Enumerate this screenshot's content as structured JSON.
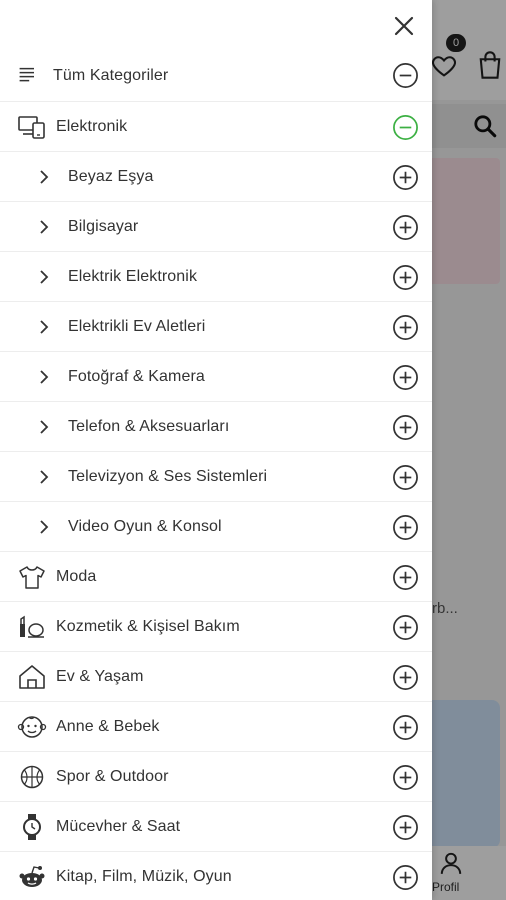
{
  "background": {
    "favorites_badge": "0",
    "product_card_text": "rb...",
    "bottom_nav": {
      "profile_label": "Profil"
    }
  },
  "drawer": {
    "all_categories": {
      "label": "Tüm Kategoriler",
      "icon": "list-icon",
      "state": "expanded"
    },
    "expanded_category": {
      "label": "Elektronik",
      "icon": "devices-icon",
      "state": "expanded",
      "accent": "#3cb043"
    },
    "subcategories": [
      {
        "label": "Beyaz Eşya"
      },
      {
        "label": "Bilgisayar"
      },
      {
        "label": "Elektrik Elektronik"
      },
      {
        "label": "Elektrikli Ev Aletleri"
      },
      {
        "label": "Fotoğraf & Kamera"
      },
      {
        "label": "Telefon & Aksesuarları"
      },
      {
        "label": "Televizyon & Ses Sistemleri"
      },
      {
        "label": "Video Oyun & Konsol"
      }
    ],
    "categories": [
      {
        "label": "Moda",
        "icon": "tshirt-icon"
      },
      {
        "label": "Kozmetik & Kişisel Bakım",
        "icon": "cosmetics-icon"
      },
      {
        "label": "Ev & Yaşam",
        "icon": "home-icon"
      },
      {
        "label": "Anne & Bebek",
        "icon": "baby-icon"
      },
      {
        "label": "Spor & Outdoor",
        "icon": "ball-icon"
      },
      {
        "label": "Mücevher & Saat",
        "icon": "watch-icon"
      },
      {
        "label": "Kitap, Film, Müzik, Oyun",
        "icon": "reddit-alien-icon"
      }
    ]
  },
  "colors": {
    "expanded_accent": "#3cb043",
    "icon_dark": "#333333"
  }
}
